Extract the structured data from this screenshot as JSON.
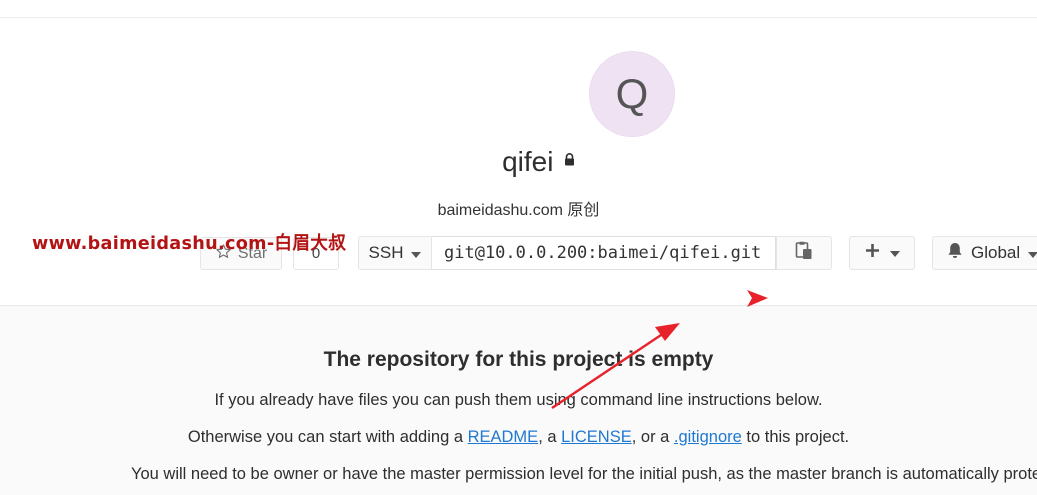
{
  "project": {
    "avatar_letter": "Q",
    "name": "qifei",
    "description": "baimeidashu.com 原创"
  },
  "watermark": "www.baimeidashu.com-白眉大叔",
  "toolbar": {
    "star_label": "Star",
    "star_count": "0",
    "protocol": "SSH",
    "clone_url": "git@10.0.0.200:baimei/qifei.git",
    "notification_level": "Global"
  },
  "empty_repo": {
    "title": "The repository for this project is empty",
    "line1": "If you already have files you can push them using command line instructions below.",
    "line2_prefix": "Otherwise you can start with adding a ",
    "readme": "README",
    "sep1": ", a ",
    "license": "LICENSE",
    "sep2": ", or a ",
    "gitignore": ".gitignore",
    "line2_suffix": " to this project.",
    "line3": "You will need to be owner or have the master permission level for the initial push, as the master branch is automatically protected."
  },
  "colors": {
    "link": "#1f78d1",
    "avatar_bg": "#efe3f3",
    "annotation_arrow": "#e8222b",
    "watermark": "#b31313"
  }
}
